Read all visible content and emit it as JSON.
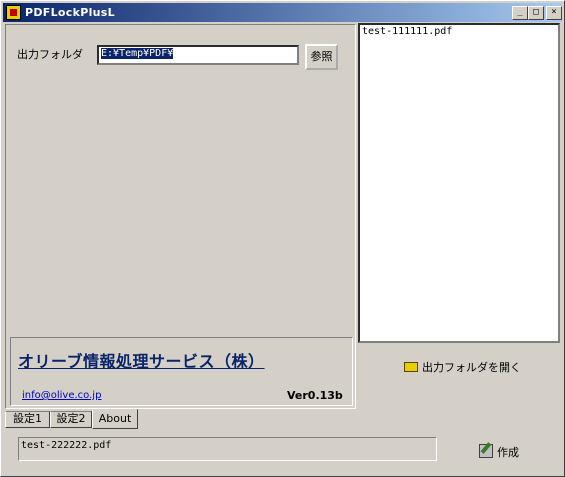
{
  "window": {
    "title": "PDFLockPlusL"
  },
  "titlebar": {
    "min": "_",
    "max": "□",
    "close": "×"
  },
  "settings": {
    "output_folder_label": "出力フォルダ",
    "output_folder_value": "E:¥Temp¥PDF¥",
    "browse_label": "参照"
  },
  "about": {
    "company": "オリーブ情報処理サービス（株）",
    "email": "info@olive.co.jp",
    "version": "Ver0.13b"
  },
  "tabs": [
    {
      "label": "設定1"
    },
    {
      "label": "設定2"
    },
    {
      "label": "About"
    }
  ],
  "file_list": {
    "items": [
      "test-111111.pdf"
    ]
  },
  "open_folder_label": "出力フォルダを開く",
  "status": {
    "filename": "test-222222.pdf"
  },
  "create_label": "作成"
}
